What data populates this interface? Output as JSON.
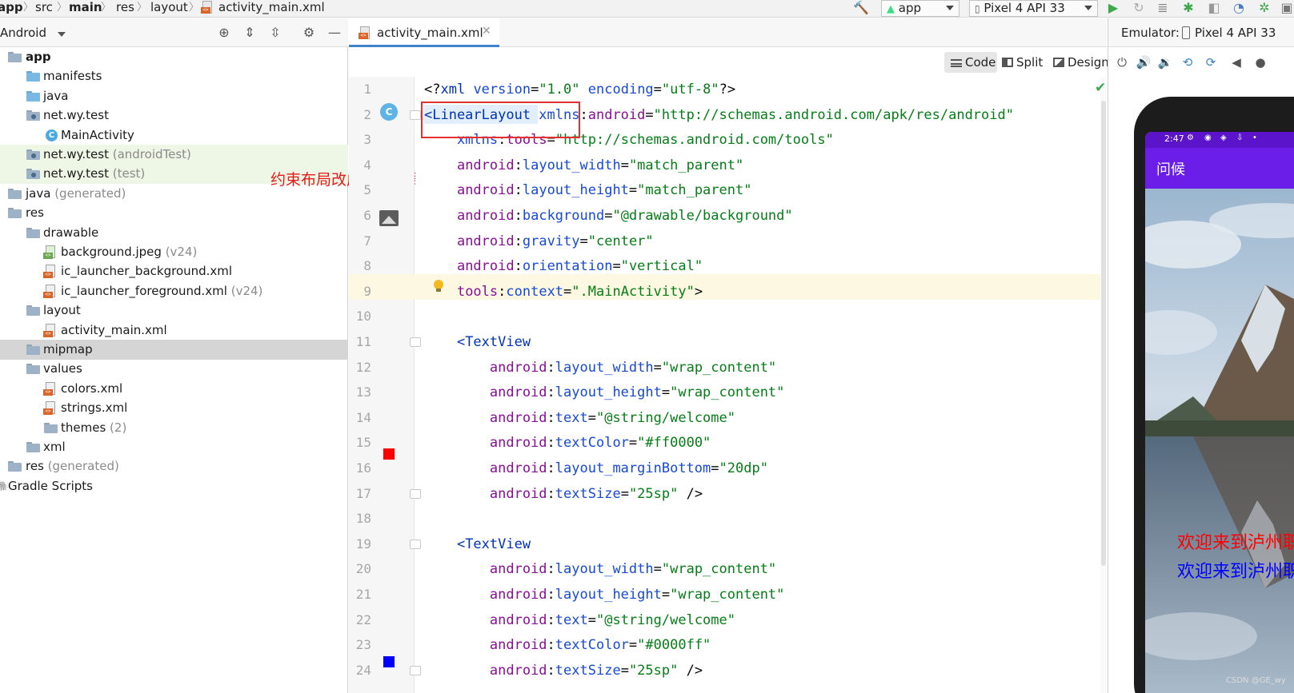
{
  "breadcrumb": [
    "app",
    "src",
    "main",
    "res",
    "layout",
    "activity_main.xml"
  ],
  "toolbar": {
    "run_config": "app",
    "device": "Pixel 4 API 33"
  },
  "project_panel": {
    "title": "Android",
    "tree": [
      {
        "label": "app",
        "depth": 0,
        "icon": "folder-icon",
        "bold": true
      },
      {
        "label": "manifests",
        "depth": 1,
        "icon": "folder-icon"
      },
      {
        "label": "java",
        "depth": 1,
        "icon": "folder-icon"
      },
      {
        "label": "net.wy.test",
        "depth": 1,
        "icon": "package-icon",
        "expanded": true
      },
      {
        "label": "MainActivity",
        "depth": 2,
        "icon": "class-icon"
      },
      {
        "label": "net.wy.test",
        "suffix": "(androidTest)",
        "depth": 1,
        "icon": "package-icon",
        "collapsed": true,
        "green": true
      },
      {
        "label": "net.wy.test",
        "suffix": "(test)",
        "depth": 1,
        "icon": "package-icon",
        "collapsed": true,
        "green": true
      },
      {
        "label": "java",
        "suffix": "(generated)",
        "depth": 0,
        "icon": "generated-folder-icon"
      },
      {
        "label": "res",
        "depth": 0,
        "icon": "res-folder-icon"
      },
      {
        "label": "drawable",
        "depth": 1,
        "icon": "folder-icon",
        "expanded": true
      },
      {
        "label": "background.jpeg",
        "suffix": "(v24)",
        "depth": 2,
        "icon": "image-file-icon"
      },
      {
        "label": "ic_launcher_background.xml",
        "depth": 2,
        "icon": "xml-file-icon"
      },
      {
        "label": "ic_launcher_foreground.xml",
        "suffix": "(v24)",
        "depth": 2,
        "icon": "xml-file-icon"
      },
      {
        "label": "layout",
        "depth": 1,
        "icon": "folder-icon",
        "expanded": true
      },
      {
        "label": "activity_main.xml",
        "depth": 2,
        "icon": "xml-file-icon"
      },
      {
        "label": "mipmap",
        "depth": 1,
        "icon": "folder-icon",
        "collapsed": true,
        "selected": true
      },
      {
        "label": "values",
        "depth": 1,
        "icon": "folder-icon",
        "expanded": true
      },
      {
        "label": "colors.xml",
        "depth": 2,
        "icon": "xml-file-icon"
      },
      {
        "label": "strings.xml",
        "depth": 2,
        "icon": "xml-file-icon"
      },
      {
        "label": "themes",
        "suffix": "(2)",
        "depth": 2,
        "icon": "folder-icon",
        "collapsed": true
      },
      {
        "label": "xml",
        "depth": 1,
        "icon": "folder-icon",
        "collapsed": true
      },
      {
        "label": "res",
        "suffix": "(generated)",
        "depth": 0,
        "icon": "res-folder-icon"
      },
      {
        "label": "Gradle Scripts",
        "depth": 0,
        "icon": "gradle-icon"
      }
    ]
  },
  "annotation": "约束布局改成线性布局",
  "editor": {
    "tab_label": "activity_main.xml",
    "view_modes": [
      "Code",
      "Split",
      "Design"
    ],
    "active_view": "Code",
    "lines": [
      {
        "n": "1",
        "parts": [
          [
            "pun",
            "<?"
          ],
          [
            "tag",
            "xml "
          ],
          [
            "attr",
            "version"
          ],
          [
            "pun",
            "="
          ],
          [
            "val",
            "\"1.0\""
          ],
          [
            "pun",
            " "
          ],
          [
            "attr",
            "encoding"
          ],
          [
            "pun",
            "="
          ],
          [
            "val",
            "\"utf-8\""
          ],
          [
            "pun",
            "?>"
          ]
        ]
      },
      {
        "n": "2",
        "parts": [
          [
            "tag",
            "<LinearLayout "
          ],
          [
            "attr",
            "xmlns"
          ],
          [
            "pun",
            ":"
          ],
          [
            "ns",
            "android"
          ],
          [
            "pun",
            "="
          ],
          [
            "val",
            "\"http://schemas.android.com/apk/res/android\""
          ]
        ]
      },
      {
        "n": "3",
        "parts": [
          [
            "pun",
            "    "
          ],
          [
            "attr",
            "xmlns"
          ],
          [
            "pun",
            ":"
          ],
          [
            "ns",
            "tools"
          ],
          [
            "pun",
            "="
          ],
          [
            "val",
            "\"http://schemas.android.com/tools\""
          ]
        ]
      },
      {
        "n": "4",
        "parts": [
          [
            "pun",
            "    "
          ],
          [
            "ns",
            "android"
          ],
          [
            "pun",
            ":"
          ],
          [
            "attr",
            "layout_width"
          ],
          [
            "pun",
            "="
          ],
          [
            "val",
            "\"match_parent\""
          ]
        ]
      },
      {
        "n": "5",
        "parts": [
          [
            "pun",
            "    "
          ],
          [
            "ns",
            "android"
          ],
          [
            "pun",
            ":"
          ],
          [
            "attr",
            "layout_height"
          ],
          [
            "pun",
            "="
          ],
          [
            "val",
            "\"match_parent\""
          ]
        ]
      },
      {
        "n": "6",
        "parts": [
          [
            "pun",
            "    "
          ],
          [
            "ns",
            "android"
          ],
          [
            "pun",
            ":"
          ],
          [
            "attr",
            "background"
          ],
          [
            "pun",
            "="
          ],
          [
            "val",
            "\"@drawable/background\""
          ]
        ]
      },
      {
        "n": "7",
        "parts": [
          [
            "pun",
            "    "
          ],
          [
            "ns",
            "android"
          ],
          [
            "pun",
            ":"
          ],
          [
            "attr",
            "gravity"
          ],
          [
            "pun",
            "="
          ],
          [
            "val",
            "\"center\""
          ]
        ]
      },
      {
        "n": "8",
        "parts": [
          [
            "pun",
            "    "
          ],
          [
            "ns",
            "android"
          ],
          [
            "pun",
            ":"
          ],
          [
            "attr",
            "orientation"
          ],
          [
            "pun",
            "="
          ],
          [
            "val",
            "\"vertical\""
          ]
        ]
      },
      {
        "n": "9",
        "parts": [
          [
            "pun",
            "    "
          ],
          [
            "ns",
            "tools"
          ],
          [
            "pun",
            ":"
          ],
          [
            "attr",
            "context"
          ],
          [
            "pun",
            "="
          ],
          [
            "val",
            "\".MainActivity\""
          ],
          [
            "pun",
            ">"
          ]
        ]
      },
      {
        "n": "10",
        "parts": []
      },
      {
        "n": "11",
        "parts": [
          [
            "pun",
            "    "
          ],
          [
            "tag",
            "<TextView"
          ]
        ]
      },
      {
        "n": "12",
        "parts": [
          [
            "pun",
            "        "
          ],
          [
            "ns",
            "android"
          ],
          [
            "pun",
            ":"
          ],
          [
            "attr",
            "layout_width"
          ],
          [
            "pun",
            "="
          ],
          [
            "val",
            "\"wrap_content\""
          ]
        ]
      },
      {
        "n": "13",
        "parts": [
          [
            "pun",
            "        "
          ],
          [
            "ns",
            "android"
          ],
          [
            "pun",
            ":"
          ],
          [
            "attr",
            "layout_height"
          ],
          [
            "pun",
            "="
          ],
          [
            "val",
            "\"wrap_content\""
          ]
        ]
      },
      {
        "n": "14",
        "parts": [
          [
            "pun",
            "        "
          ],
          [
            "ns",
            "android"
          ],
          [
            "pun",
            ":"
          ],
          [
            "attr",
            "text"
          ],
          [
            "pun",
            "="
          ],
          [
            "val",
            "\"@string/welcome\""
          ]
        ]
      },
      {
        "n": "15",
        "parts": [
          [
            "pun",
            "        "
          ],
          [
            "ns",
            "android"
          ],
          [
            "pun",
            ":"
          ],
          [
            "attr",
            "textColor"
          ],
          [
            "pun",
            "="
          ],
          [
            "val",
            "\"#ff0000\""
          ]
        ]
      },
      {
        "n": "16",
        "parts": [
          [
            "pun",
            "        "
          ],
          [
            "ns",
            "android"
          ],
          [
            "pun",
            ":"
          ],
          [
            "attr",
            "layout_marginBottom"
          ],
          [
            "pun",
            "="
          ],
          [
            "val",
            "\"20dp\""
          ]
        ]
      },
      {
        "n": "17",
        "parts": [
          [
            "pun",
            "        "
          ],
          [
            "ns",
            "android"
          ],
          [
            "pun",
            ":"
          ],
          [
            "attr",
            "textSize"
          ],
          [
            "pun",
            "="
          ],
          [
            "val",
            "\"25sp\""
          ],
          [
            "pun",
            " />"
          ]
        ]
      },
      {
        "n": "18",
        "parts": []
      },
      {
        "n": "19",
        "parts": [
          [
            "pun",
            "    "
          ],
          [
            "tag",
            "<TextView"
          ]
        ]
      },
      {
        "n": "20",
        "parts": [
          [
            "pun",
            "        "
          ],
          [
            "ns",
            "android"
          ],
          [
            "pun",
            ":"
          ],
          [
            "attr",
            "layout_width"
          ],
          [
            "pun",
            "="
          ],
          [
            "val",
            "\"wrap_content\""
          ]
        ]
      },
      {
        "n": "21",
        "parts": [
          [
            "pun",
            "        "
          ],
          [
            "ns",
            "android"
          ],
          [
            "pun",
            ":"
          ],
          [
            "attr",
            "layout_height"
          ],
          [
            "pun",
            "="
          ],
          [
            "val",
            "\"wrap_content\""
          ]
        ]
      },
      {
        "n": "22",
        "parts": [
          [
            "pun",
            "        "
          ],
          [
            "ns",
            "android"
          ],
          [
            "pun",
            ":"
          ],
          [
            "attr",
            "text"
          ],
          [
            "pun",
            "="
          ],
          [
            "val",
            "\"@string/welcome\""
          ]
        ]
      },
      {
        "n": "23",
        "parts": [
          [
            "pun",
            "        "
          ],
          [
            "ns",
            "android"
          ],
          [
            "pun",
            ":"
          ],
          [
            "attr",
            "textColor"
          ],
          [
            "pun",
            "="
          ],
          [
            "val",
            "\"#0000ff\""
          ]
        ]
      },
      {
        "n": "24",
        "parts": [
          [
            "pun",
            "        "
          ],
          [
            "ns",
            "android"
          ],
          [
            "pun",
            ":"
          ],
          [
            "attr",
            "textSize"
          ],
          [
            "pun",
            "="
          ],
          [
            "val",
            "\"25sp\""
          ],
          [
            "pun",
            " />"
          ]
        ]
      }
    ],
    "swatch_colors": {
      "15": "#ff0000",
      "23": "#0000ff"
    }
  },
  "emulator": {
    "label": "Emulator:",
    "device": "Pixel 4 API 33",
    "status_time": "2:47",
    "app_title": "问候",
    "welcome_text": "欢迎来到泸州职业技术学院",
    "welcome_colors": [
      "#ff0000",
      "#0000ff"
    ]
  },
  "watermark": "CSDN @GE_wy"
}
